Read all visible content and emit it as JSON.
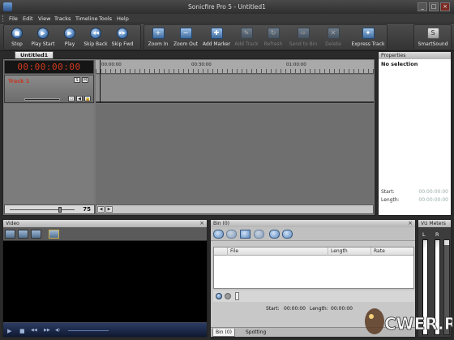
{
  "window": {
    "title": "Sonicfire Pro 5 - Untitled1",
    "minimize": "_",
    "maximize": "□",
    "close": "×"
  },
  "menu": [
    "File",
    "Edit",
    "View",
    "Tracks",
    "Timeline",
    "Tools",
    "Help"
  ],
  "toolbar": {
    "transport": [
      {
        "label": "Stop",
        "glyph": "■"
      },
      {
        "label": "Play Start",
        "glyph": "▶"
      },
      {
        "label": "Play",
        "glyph": "▶"
      },
      {
        "label": "Skip Back",
        "glyph": "◀◀"
      },
      {
        "label": "Skip Fwd",
        "glyph": "▶▶"
      }
    ],
    "edit": [
      {
        "label": "Zoom In",
        "glyph": "+",
        "enabled": true
      },
      {
        "label": "Zoom Out",
        "glyph": "−",
        "enabled": true
      },
      {
        "label": "Add Marker",
        "glyph": "✚",
        "enabled": true
      },
      {
        "label": "Add Track",
        "glyph": "✎",
        "enabled": false
      },
      {
        "label": "Refresh",
        "glyph": "↻",
        "enabled": false
      },
      {
        "label": "Send to Bin",
        "glyph": "⇨",
        "enabled": false
      },
      {
        "label": "Delete",
        "glyph": "✕",
        "enabled": false
      },
      {
        "label": "Express Track",
        "glyph": "✦",
        "enabled": true
      }
    ],
    "smartsound": {
      "label": "SmartSound",
      "glyph": "S"
    }
  },
  "document_tab": {
    "label": "Untitled1"
  },
  "timeline": {
    "counter": "00:00:00:00",
    "ruler_ticks": [
      "00:00:00",
      "00:30:00",
      "01:00:00"
    ],
    "tracks": [
      {
        "name": "Track 1",
        "buttons": [
          "S",
          "M",
          "R"
        ],
        "icons": [
          "▭",
          "◀",
          "🔒"
        ]
      }
    ],
    "zoom_value": "75",
    "scroll_left": "◀",
    "scroll_right": "▶"
  },
  "properties": {
    "title": "Properties",
    "selection": "No selection",
    "start_label": "Start:",
    "start_value": "00:00:00:00",
    "length_label": "Length:",
    "length_value": "00:00:00:00"
  },
  "video": {
    "title": "Video",
    "controls": [
      "▶",
      "■",
      "◀◀",
      "▶▶",
      "◀)"
    ]
  },
  "bin": {
    "title": "Bin (0)",
    "columns": [
      "",
      "File",
      "Length",
      "Rate"
    ],
    "start_label": "Start:",
    "start_value": "00:00:00",
    "length_label": "Length:",
    "length_value": "00:00:00",
    "tabs": [
      "Bin (0)",
      "Spotting"
    ]
  },
  "vu": {
    "title": "VU Meters",
    "left": "L",
    "right": "R"
  },
  "watermark": "CWER.RU"
}
